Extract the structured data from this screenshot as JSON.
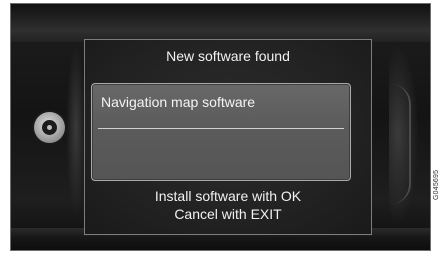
{
  "dialog": {
    "title": "New software found",
    "item_label": "Navigation map software",
    "instruction_ok": "Install software with OK",
    "instruction_exit": "Cancel with EXIT"
  },
  "figure": {
    "code": "G045695"
  },
  "colors": {
    "screen_bg": "#232323",
    "panel_bg": "#5e5e5e",
    "text": "#f2f2f2"
  }
}
